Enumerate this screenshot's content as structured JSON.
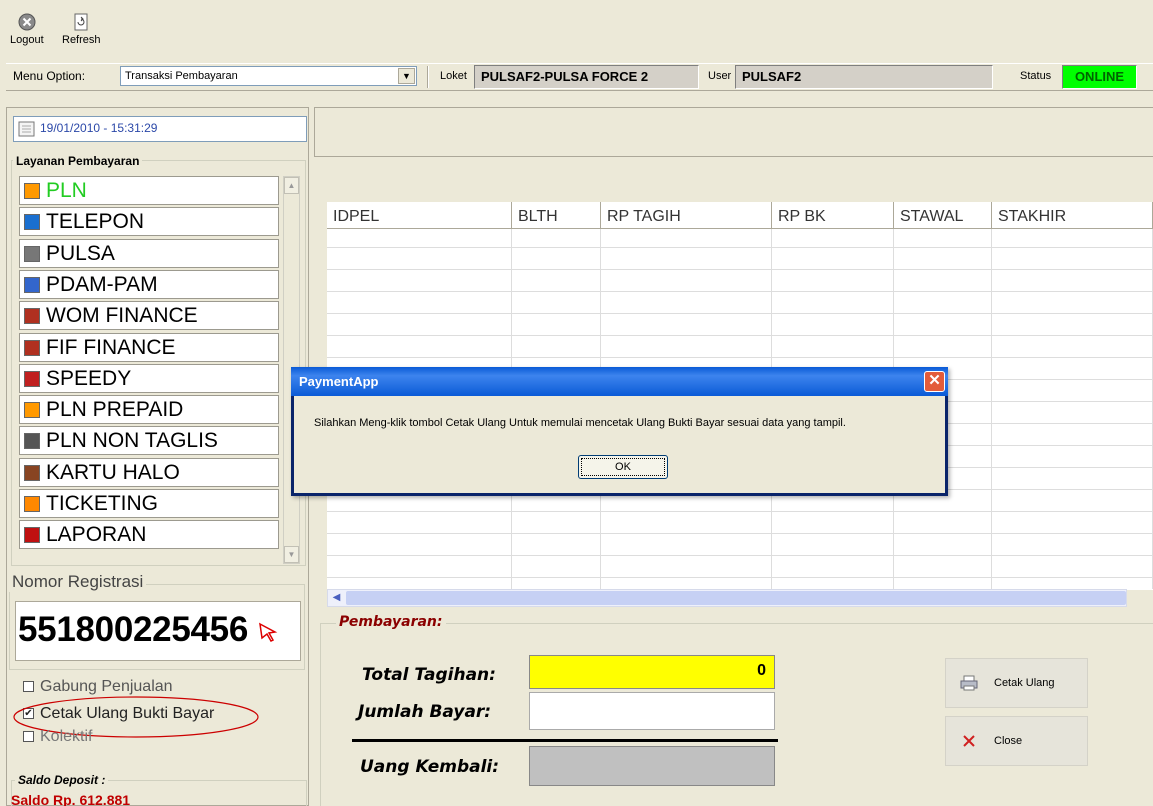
{
  "toolbar": {
    "logout_label": "Logout",
    "refresh_label": "Refresh"
  },
  "menubar": {
    "menu_option_label": "Menu Option:",
    "menu_option_value": "Transaksi Pembayaran",
    "loket_label": "Loket",
    "loket_value": "PULSAF2-PULSA FORCE 2",
    "user_label": "User",
    "user_value": "PULSAF2",
    "status_label": "Status",
    "status_value": "ONLINE",
    "status_color": "#00ff00"
  },
  "sidebar": {
    "datetime": "19/01/2010 - 15:31:29",
    "services_title": "Layanan Pembayaran",
    "services": [
      {
        "label": "PLN",
        "icon": "pln-icon",
        "selected": true
      },
      {
        "label": "TELEPON",
        "icon": "telepon-icon"
      },
      {
        "label": "PULSA",
        "icon": "pulsa-icon"
      },
      {
        "label": "PDAM-PAM",
        "icon": "pdam-icon"
      },
      {
        "label": "WOM FINANCE",
        "icon": "wom-icon"
      },
      {
        "label": "FIF FINANCE",
        "icon": "fif-icon"
      },
      {
        "label": "SPEEDY",
        "icon": "speedy-icon"
      },
      {
        "label": "PLN PREPAID",
        "icon": "pln-prepaid-icon"
      },
      {
        "label": "PLN NON TAGLIS",
        "icon": "pln-nontaglis-icon"
      },
      {
        "label": "KARTU HALO",
        "icon": "kartu-halo-icon"
      },
      {
        "label": "TICKETING",
        "icon": "ticketing-icon"
      },
      {
        "label": "LAPORAN",
        "icon": "laporan-icon"
      }
    ],
    "reg_title": "Nomor Registrasi",
    "reg_value": "551800225456",
    "checkboxes": [
      {
        "label": "Gabung Penjualan",
        "checked": false
      },
      {
        "label": "Cetak Ulang Bukti Bayar",
        "checked": true
      },
      {
        "label": "Kolektif",
        "checked": false
      }
    ],
    "saldo_title": "Saldo Deposit :",
    "saldo_value": "Saldo Rp. 612.881"
  },
  "grid": {
    "columns": [
      "IDPEL",
      "BLTH",
      "RP TAGIH",
      "RP BK",
      "STAWAL",
      "STAKHIR"
    ]
  },
  "payment": {
    "section_title": "Pembayaran:",
    "total_label": "Total Tagihan:",
    "total_value": "0",
    "jumlah_label": "Jumlah Bayar:",
    "jumlah_value": "",
    "kembali_label": "Uang Kembali:",
    "kembali_value": "",
    "cetak_button": "Cetak Ulang",
    "close_button": "Close"
  },
  "dialog": {
    "title": "PaymentApp",
    "message": "Silahkan Meng-klik tombol Cetak Ulang Untuk memulai mencetak Ulang Bukti Bayar sesuai data yang tampil.",
    "ok_label": "OK",
    "close_glyph": "✕"
  }
}
